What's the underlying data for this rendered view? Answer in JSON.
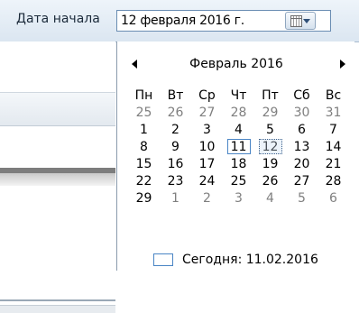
{
  "form": {
    "date_label": "Дата начала",
    "date_value": "12 февраля 2016 г."
  },
  "calendar": {
    "month_title": "Февраль 2016",
    "weekdays": [
      "Пн",
      "Вт",
      "Ср",
      "Чт",
      "Пт",
      "Сб",
      "Вс"
    ],
    "weeks": [
      [
        "25",
        "26",
        "27",
        "28",
        "29",
        "30",
        "31"
      ],
      [
        "1",
        "2",
        "3",
        "4",
        "5",
        "6",
        "7"
      ],
      [
        "8",
        "9",
        "10",
        "11",
        "12",
        "13",
        "14"
      ],
      [
        "15",
        "16",
        "17",
        "18",
        "19",
        "20",
        "21"
      ],
      [
        "22",
        "23",
        "24",
        "25",
        "26",
        "27",
        "28"
      ],
      [
        "29",
        "1",
        "2",
        "3",
        "4",
        "5",
        "6"
      ]
    ],
    "today_label": "Сегодня: 11.02.2016"
  },
  "colors": {
    "accent": "#4a85c5",
    "muted_day": "#7f7f7f"
  },
  "icons": {
    "prev": "chevron-left-icon",
    "next": "chevron-right-icon",
    "dropdown": "calendar-icon"
  }
}
